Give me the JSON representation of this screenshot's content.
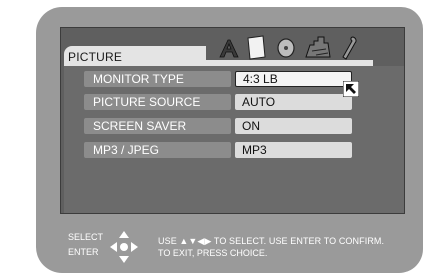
{
  "menu": {
    "title": "PICTURE",
    "icons": [
      "audio-a-icon",
      "page-icon",
      "disc-icon",
      "castle-icon",
      "wrench-icon"
    ],
    "rows": [
      {
        "label": "MONITOR TYPE",
        "value": "4:3 LB",
        "selected": true
      },
      {
        "label": "PICTURE SOURCE",
        "value": "AUTO",
        "selected": false
      },
      {
        "label": "SCREEN SAVER",
        "value": "ON",
        "selected": false
      },
      {
        "label": "MP3 / JPEG",
        "value": "MP3",
        "selected": false
      }
    ]
  },
  "footer": {
    "select_label": "SELECT",
    "enter_label": "ENTER",
    "line1": "USE ▲▼◀▶ TO SELECT.  USE ENTER TO CONFIRM.",
    "line2": "TO EXIT, PRESS CHOICE."
  },
  "colors": {
    "screen": "#9a9a9a",
    "panel": "#6b6b6b",
    "label_bg": "#8c8c8c",
    "value_bg": "#dcdcdc"
  }
}
